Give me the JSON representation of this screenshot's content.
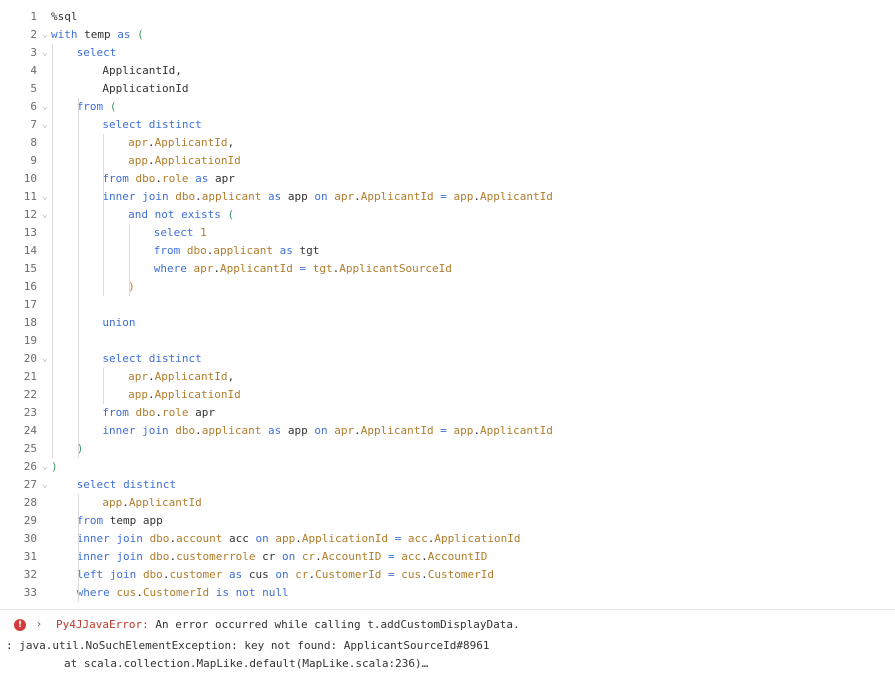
{
  "lines": [
    {
      "n": "1",
      "fold": false,
      "indent": 0,
      "tokens": [
        {
          "t": "%sql",
          "c": "plain"
        }
      ]
    },
    {
      "n": "2",
      "fold": true,
      "indent": 0,
      "tokens": [
        {
          "t": "with",
          "c": "kw"
        },
        {
          "t": " temp ",
          "c": "plain"
        },
        {
          "t": "as",
          "c": "kw"
        },
        {
          "t": " ",
          "c": "plain"
        },
        {
          "t": "(",
          "c": "pn"
        }
      ]
    },
    {
      "n": "3",
      "fold": true,
      "indent": 1,
      "tokens": [
        {
          "t": "select",
          "c": "kw"
        }
      ]
    },
    {
      "n": "4",
      "fold": false,
      "indent": 2,
      "tokens": [
        {
          "t": "ApplicantId,",
          "c": "plain"
        }
      ]
    },
    {
      "n": "5",
      "fold": false,
      "indent": 2,
      "tokens": [
        {
          "t": "ApplicationId",
          "c": "plain"
        }
      ]
    },
    {
      "n": "6",
      "fold": true,
      "indent": 1,
      "tokens": [
        {
          "t": "from",
          "c": "kw"
        },
        {
          "t": " ",
          "c": "plain"
        },
        {
          "t": "(",
          "c": "pn"
        }
      ]
    },
    {
      "n": "7",
      "fold": true,
      "indent": 2,
      "tokens": [
        {
          "t": "select",
          "c": "kw"
        },
        {
          "t": " ",
          "c": "plain"
        },
        {
          "t": "distinct",
          "c": "kw"
        }
      ]
    },
    {
      "n": "8",
      "fold": false,
      "indent": 3,
      "tokens": [
        {
          "t": "apr",
          "c": "id"
        },
        {
          "t": ".",
          "c": "plain"
        },
        {
          "t": "ApplicantId",
          "c": "id"
        },
        {
          "t": ",",
          "c": "plain"
        }
      ]
    },
    {
      "n": "9",
      "fold": false,
      "indent": 3,
      "tokens": [
        {
          "t": "app",
          "c": "id"
        },
        {
          "t": ".",
          "c": "plain"
        },
        {
          "t": "ApplicationId",
          "c": "id"
        }
      ]
    },
    {
      "n": "10",
      "fold": false,
      "indent": 2,
      "tokens": [
        {
          "t": "from",
          "c": "kw"
        },
        {
          "t": " ",
          "c": "plain"
        },
        {
          "t": "dbo",
          "c": "id"
        },
        {
          "t": ".",
          "c": "plain"
        },
        {
          "t": "role",
          "c": "id"
        },
        {
          "t": " ",
          "c": "plain"
        },
        {
          "t": "as",
          "c": "kw"
        },
        {
          "t": " apr",
          "c": "plain"
        }
      ]
    },
    {
      "n": "11",
      "fold": true,
      "indent": 2,
      "tokens": [
        {
          "t": "inner",
          "c": "kw"
        },
        {
          "t": " ",
          "c": "plain"
        },
        {
          "t": "join",
          "c": "kw"
        },
        {
          "t": " ",
          "c": "plain"
        },
        {
          "t": "dbo",
          "c": "id"
        },
        {
          "t": ".",
          "c": "plain"
        },
        {
          "t": "applicant",
          "c": "id"
        },
        {
          "t": " ",
          "c": "plain"
        },
        {
          "t": "as",
          "c": "kw"
        },
        {
          "t": " app ",
          "c": "plain"
        },
        {
          "t": "on",
          "c": "kw"
        },
        {
          "t": " ",
          "c": "plain"
        },
        {
          "t": "apr",
          "c": "id"
        },
        {
          "t": ".",
          "c": "plain"
        },
        {
          "t": "ApplicantId",
          "c": "id"
        },
        {
          "t": " ",
          "c": "plain"
        },
        {
          "t": "=",
          "c": "op"
        },
        {
          "t": " ",
          "c": "plain"
        },
        {
          "t": "app",
          "c": "id"
        },
        {
          "t": ".",
          "c": "plain"
        },
        {
          "t": "ApplicantId",
          "c": "id"
        }
      ]
    },
    {
      "n": "12",
      "fold": true,
      "indent": 3,
      "tokens": [
        {
          "t": "and",
          "c": "kw"
        },
        {
          "t": " ",
          "c": "plain"
        },
        {
          "t": "not",
          "c": "kw"
        },
        {
          "t": " ",
          "c": "plain"
        },
        {
          "t": "exists",
          "c": "kw"
        },
        {
          "t": " ",
          "c": "plain"
        },
        {
          "t": "(",
          "c": "pn"
        }
      ]
    },
    {
      "n": "13",
      "fold": false,
      "indent": 4,
      "tokens": [
        {
          "t": "select",
          "c": "kw"
        },
        {
          "t": " ",
          "c": "plain"
        },
        {
          "t": "1",
          "c": "id"
        }
      ]
    },
    {
      "n": "14",
      "fold": false,
      "indent": 4,
      "tokens": [
        {
          "t": "from",
          "c": "kw"
        },
        {
          "t": " ",
          "c": "plain"
        },
        {
          "t": "dbo",
          "c": "id"
        },
        {
          "t": ".",
          "c": "plain"
        },
        {
          "t": "applicant",
          "c": "id"
        },
        {
          "t": " ",
          "c": "plain"
        },
        {
          "t": "as",
          "c": "kw"
        },
        {
          "t": " tgt",
          "c": "plain"
        }
      ]
    },
    {
      "n": "15",
      "fold": false,
      "indent": 4,
      "tokens": [
        {
          "t": "where",
          "c": "kw"
        },
        {
          "t": " ",
          "c": "plain"
        },
        {
          "t": "apr",
          "c": "id"
        },
        {
          "t": ".",
          "c": "plain"
        },
        {
          "t": "ApplicantId",
          "c": "id"
        },
        {
          "t": " ",
          "c": "plain"
        },
        {
          "t": "=",
          "c": "op"
        },
        {
          "t": " ",
          "c": "plain"
        },
        {
          "t": "tgt",
          "c": "id"
        },
        {
          "t": ".",
          "c": "plain"
        },
        {
          "t": "ApplicantSourceId",
          "c": "id"
        }
      ]
    },
    {
      "n": "16",
      "fold": false,
      "indent": 3,
      "tokens": [
        {
          "t": ")",
          "c": "pr"
        }
      ]
    },
    {
      "n": "17",
      "fold": false,
      "indent": 0,
      "tokens": []
    },
    {
      "n": "18",
      "fold": false,
      "indent": 2,
      "tokens": [
        {
          "t": "union",
          "c": "kw"
        }
      ]
    },
    {
      "n": "19",
      "fold": false,
      "indent": 0,
      "tokens": []
    },
    {
      "n": "20",
      "fold": true,
      "indent": 2,
      "tokens": [
        {
          "t": "select",
          "c": "kw"
        },
        {
          "t": " ",
          "c": "plain"
        },
        {
          "t": "distinct",
          "c": "kw"
        }
      ]
    },
    {
      "n": "21",
      "fold": false,
      "indent": 3,
      "tokens": [
        {
          "t": "apr",
          "c": "id"
        },
        {
          "t": ".",
          "c": "plain"
        },
        {
          "t": "ApplicantId",
          "c": "id"
        },
        {
          "t": ",",
          "c": "plain"
        }
      ]
    },
    {
      "n": "22",
      "fold": false,
      "indent": 3,
      "tokens": [
        {
          "t": "app",
          "c": "id"
        },
        {
          "t": ".",
          "c": "plain"
        },
        {
          "t": "ApplicationId",
          "c": "id"
        }
      ]
    },
    {
      "n": "23",
      "fold": false,
      "indent": 2,
      "tokens": [
        {
          "t": "from",
          "c": "kw"
        },
        {
          "t": " ",
          "c": "plain"
        },
        {
          "t": "dbo",
          "c": "id"
        },
        {
          "t": ".",
          "c": "plain"
        },
        {
          "t": "role",
          "c": "id"
        },
        {
          "t": " apr",
          "c": "plain"
        }
      ]
    },
    {
      "n": "24",
      "fold": false,
      "indent": 2,
      "tokens": [
        {
          "t": "inner",
          "c": "kw"
        },
        {
          "t": " ",
          "c": "plain"
        },
        {
          "t": "join",
          "c": "kw"
        },
        {
          "t": " ",
          "c": "plain"
        },
        {
          "t": "dbo",
          "c": "id"
        },
        {
          "t": ".",
          "c": "plain"
        },
        {
          "t": "applicant",
          "c": "id"
        },
        {
          "t": " ",
          "c": "plain"
        },
        {
          "t": "as",
          "c": "kw"
        },
        {
          "t": " app ",
          "c": "plain"
        },
        {
          "t": "on",
          "c": "kw"
        },
        {
          "t": " ",
          "c": "plain"
        },
        {
          "t": "apr",
          "c": "id"
        },
        {
          "t": ".",
          "c": "plain"
        },
        {
          "t": "ApplicantId",
          "c": "id"
        },
        {
          "t": " ",
          "c": "plain"
        },
        {
          "t": "=",
          "c": "op"
        },
        {
          "t": " ",
          "c": "plain"
        },
        {
          "t": "app",
          "c": "id"
        },
        {
          "t": ".",
          "c": "plain"
        },
        {
          "t": "ApplicantId",
          "c": "id"
        }
      ]
    },
    {
      "n": "25",
      "fold": false,
      "indent": 1,
      "tokens": [
        {
          "t": ")",
          "c": "pn"
        }
      ]
    },
    {
      "n": "26",
      "fold": true,
      "indent": 0,
      "tokens": [
        {
          "t": ")",
          "c": "pn"
        }
      ]
    },
    {
      "n": "27",
      "fold": true,
      "indent": 1,
      "tokens": [
        {
          "t": "select",
          "c": "kw"
        },
        {
          "t": " ",
          "c": "plain"
        },
        {
          "t": "distinct",
          "c": "kw"
        }
      ]
    },
    {
      "n": "28",
      "fold": false,
      "indent": 2,
      "tokens": [
        {
          "t": "app",
          "c": "id"
        },
        {
          "t": ".",
          "c": "plain"
        },
        {
          "t": "ApplicantId",
          "c": "id"
        }
      ]
    },
    {
      "n": "29",
      "fold": false,
      "indent": 1,
      "tokens": [
        {
          "t": "from",
          "c": "kw"
        },
        {
          "t": " temp app",
          "c": "plain"
        }
      ]
    },
    {
      "n": "30",
      "fold": false,
      "indent": 1,
      "tokens": [
        {
          "t": "inner",
          "c": "kw"
        },
        {
          "t": " ",
          "c": "plain"
        },
        {
          "t": "join",
          "c": "kw"
        },
        {
          "t": " ",
          "c": "plain"
        },
        {
          "t": "dbo",
          "c": "id"
        },
        {
          "t": ".",
          "c": "plain"
        },
        {
          "t": "account",
          "c": "id"
        },
        {
          "t": " acc ",
          "c": "plain"
        },
        {
          "t": "on",
          "c": "kw"
        },
        {
          "t": " ",
          "c": "plain"
        },
        {
          "t": "app",
          "c": "id"
        },
        {
          "t": ".",
          "c": "plain"
        },
        {
          "t": "ApplicationId",
          "c": "id"
        },
        {
          "t": " ",
          "c": "plain"
        },
        {
          "t": "=",
          "c": "op"
        },
        {
          "t": " ",
          "c": "plain"
        },
        {
          "t": "acc",
          "c": "id"
        },
        {
          "t": ".",
          "c": "plain"
        },
        {
          "t": "ApplicationId",
          "c": "id"
        }
      ]
    },
    {
      "n": "31",
      "fold": false,
      "indent": 1,
      "tokens": [
        {
          "t": "inner",
          "c": "kw"
        },
        {
          "t": " ",
          "c": "plain"
        },
        {
          "t": "join",
          "c": "kw"
        },
        {
          "t": " ",
          "c": "plain"
        },
        {
          "t": "dbo",
          "c": "id"
        },
        {
          "t": ".",
          "c": "plain"
        },
        {
          "t": "customerrole",
          "c": "id"
        },
        {
          "t": " cr ",
          "c": "plain"
        },
        {
          "t": "on",
          "c": "kw"
        },
        {
          "t": " ",
          "c": "plain"
        },
        {
          "t": "cr",
          "c": "id"
        },
        {
          "t": ".",
          "c": "plain"
        },
        {
          "t": "AccountID",
          "c": "id"
        },
        {
          "t": " ",
          "c": "plain"
        },
        {
          "t": "=",
          "c": "op"
        },
        {
          "t": " ",
          "c": "plain"
        },
        {
          "t": "acc",
          "c": "id"
        },
        {
          "t": ".",
          "c": "plain"
        },
        {
          "t": "AccountID",
          "c": "id"
        }
      ]
    },
    {
      "n": "32",
      "fold": false,
      "indent": 1,
      "tokens": [
        {
          "t": "left",
          "c": "kw"
        },
        {
          "t": " ",
          "c": "plain"
        },
        {
          "t": "join",
          "c": "kw"
        },
        {
          "t": " ",
          "c": "plain"
        },
        {
          "t": "dbo",
          "c": "id"
        },
        {
          "t": ".",
          "c": "plain"
        },
        {
          "t": "customer",
          "c": "id"
        },
        {
          "t": " ",
          "c": "plain"
        },
        {
          "t": "as",
          "c": "kw"
        },
        {
          "t": " cus ",
          "c": "plain"
        },
        {
          "t": "on",
          "c": "kw"
        },
        {
          "t": " ",
          "c": "plain"
        },
        {
          "t": "cr",
          "c": "id"
        },
        {
          "t": ".",
          "c": "plain"
        },
        {
          "t": "CustomerId",
          "c": "id"
        },
        {
          "t": " ",
          "c": "plain"
        },
        {
          "t": "=",
          "c": "op"
        },
        {
          "t": " ",
          "c": "plain"
        },
        {
          "t": "cus",
          "c": "id"
        },
        {
          "t": ".",
          "c": "plain"
        },
        {
          "t": "CustomerId",
          "c": "id"
        }
      ]
    },
    {
      "n": "33",
      "fold": false,
      "indent": 1,
      "tokens": [
        {
          "t": "where",
          "c": "kw"
        },
        {
          "t": " ",
          "c": "plain"
        },
        {
          "t": "cus",
          "c": "id"
        },
        {
          "t": ".",
          "c": "plain"
        },
        {
          "t": "CustomerId",
          "c": "id"
        },
        {
          "t": " ",
          "c": "plain"
        },
        {
          "t": "is",
          "c": "kw"
        },
        {
          "t": " ",
          "c": "plain"
        },
        {
          "t": "not",
          "c": "kw"
        },
        {
          "t": " ",
          "c": "plain"
        },
        {
          "t": "null",
          "c": "kw"
        }
      ]
    }
  ],
  "error": {
    "icon": "error-icon",
    "icon_glyph": "!",
    "chevron_glyph": "›",
    "type": "Py4JJavaError:",
    "message": " An error occurred while calling t.addCustomDisplayData.",
    "trace_line1": ": java.util.NoSuchElementException: key not found: ApplicantSourceId#8961",
    "trace_line2": "at scala.collection.MapLike.default(MapLike.scala:236)…"
  },
  "colors": {
    "keyword": "#3f6fd8",
    "identifier": "#b07d2b",
    "paren": "#3f9a6a",
    "error": "#d63b3b"
  }
}
